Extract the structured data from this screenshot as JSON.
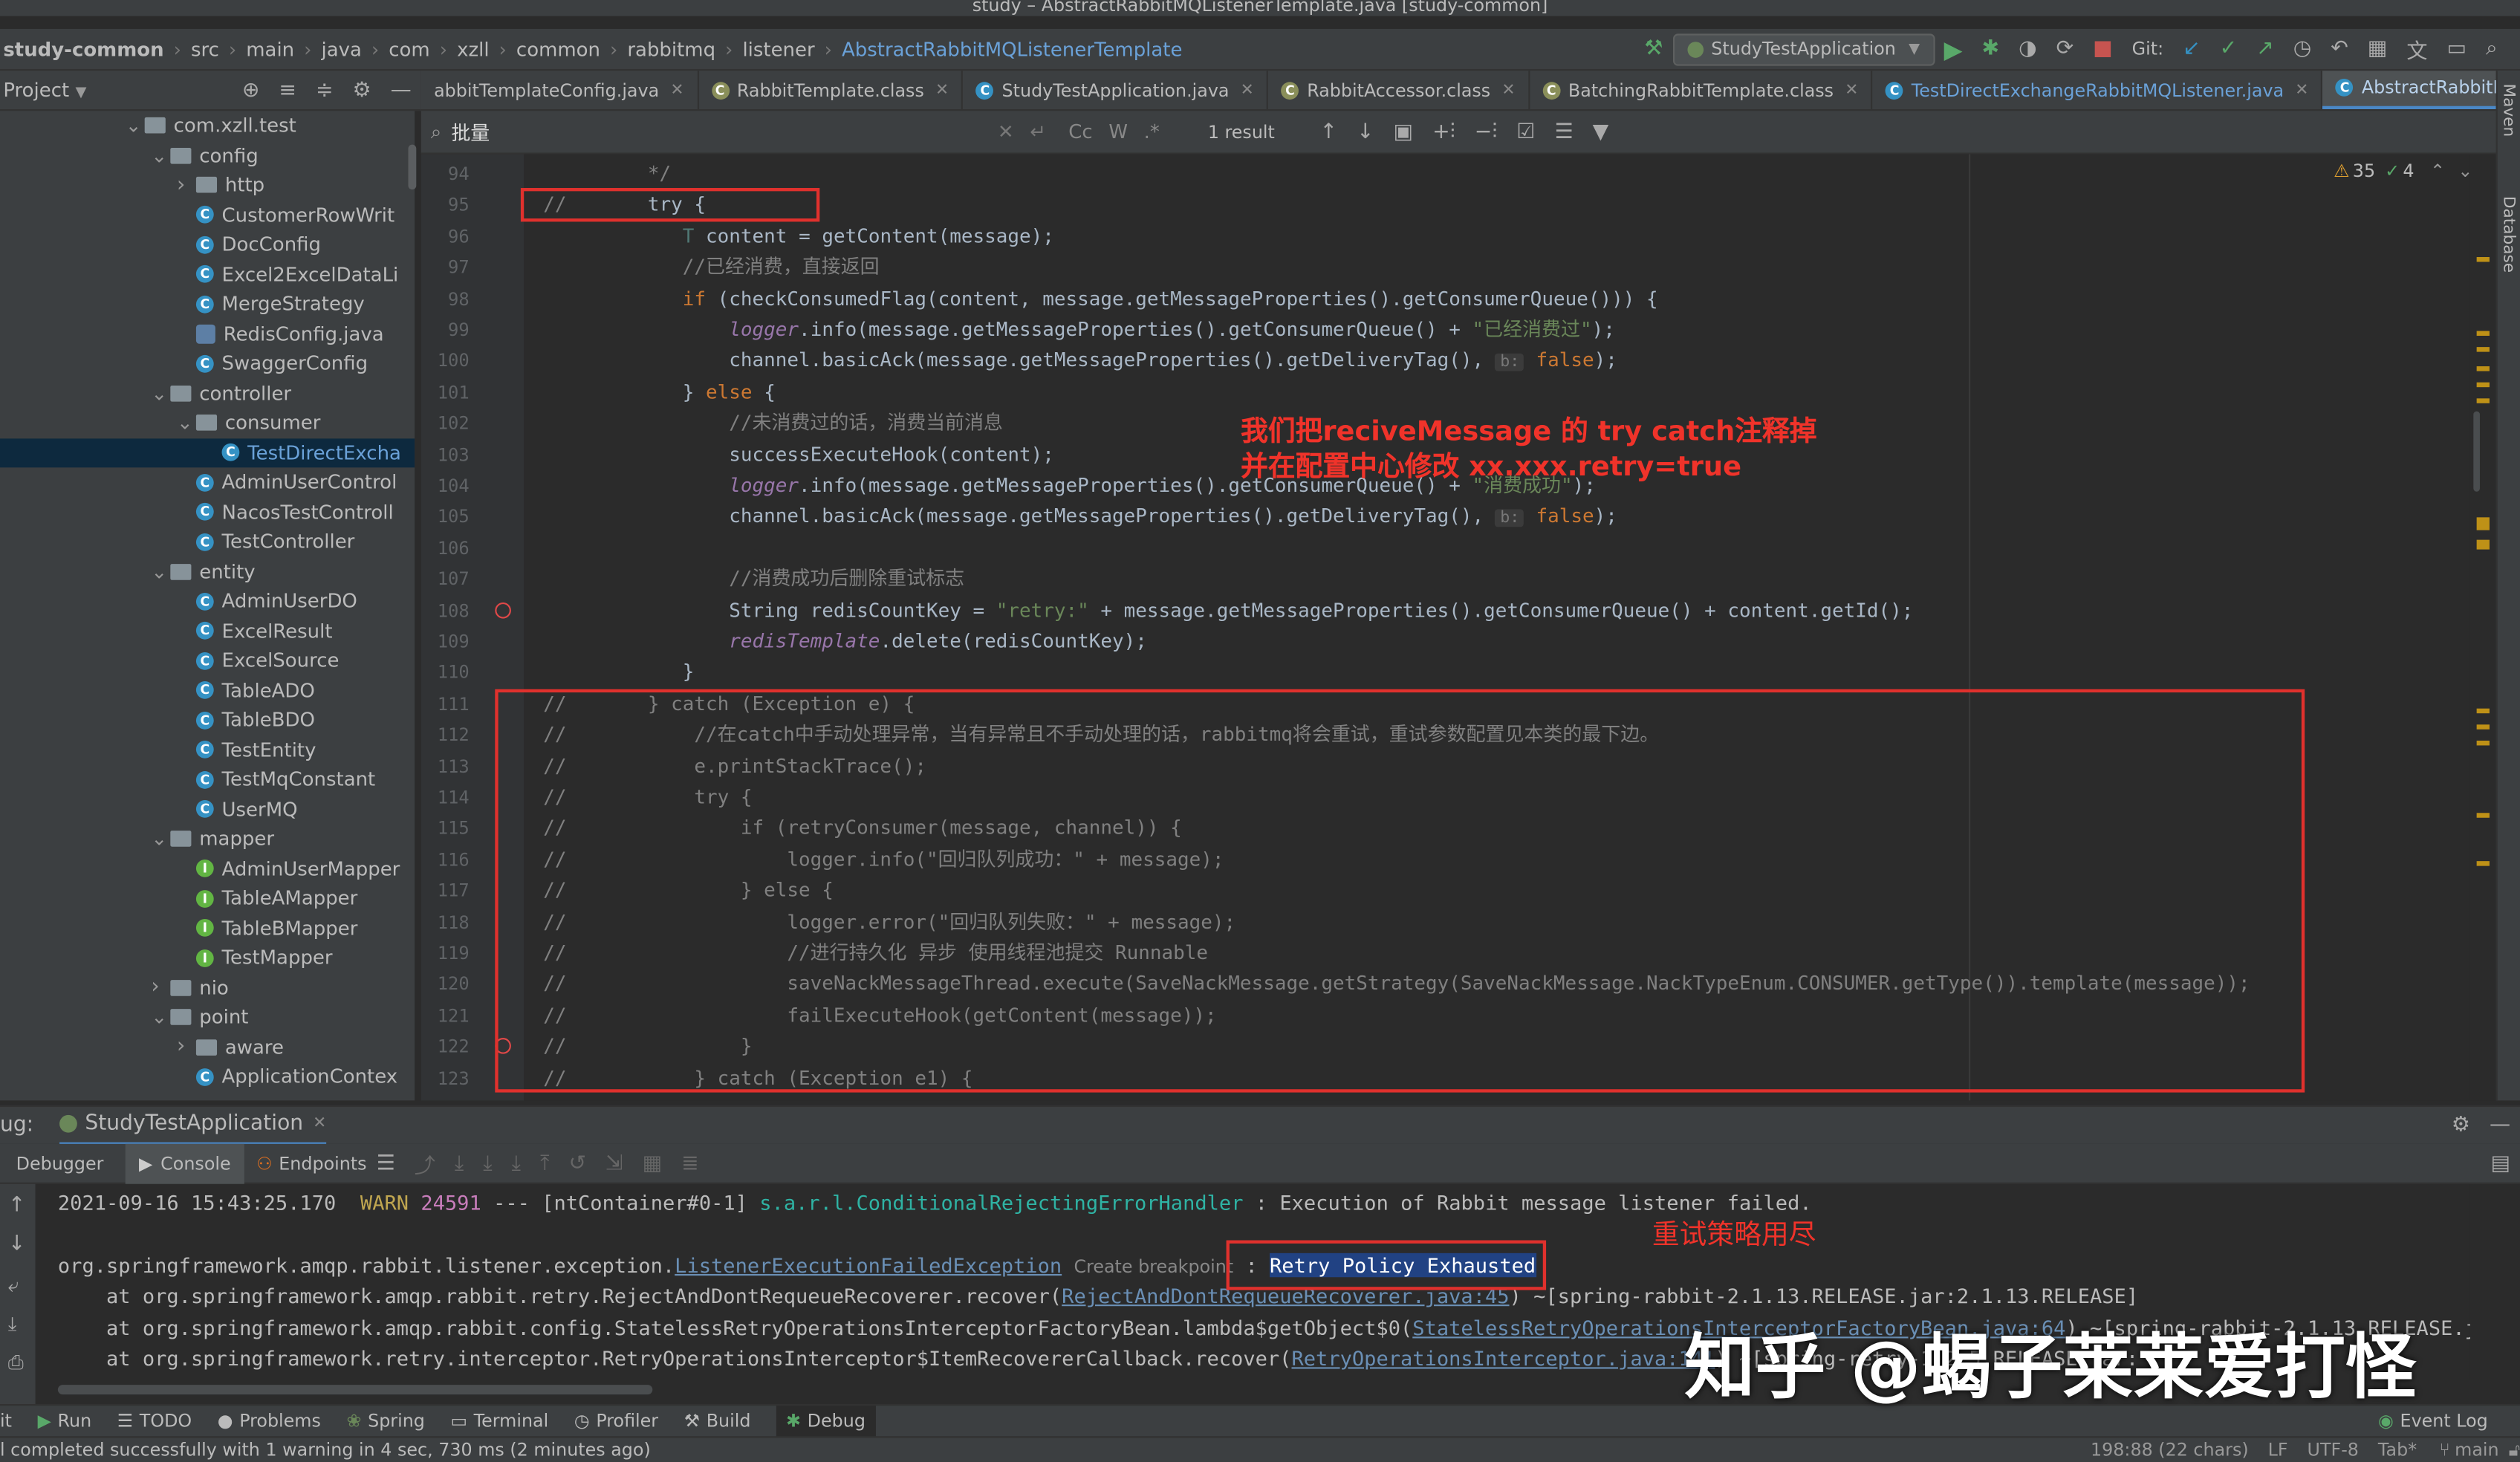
{
  "window_title": "study – AbstractRabbitMQListenerTemplate.java [study-common]",
  "breadcrumb": [
    "study-common",
    "src",
    "main",
    "java",
    "com",
    "xzll",
    "common",
    "rabbitmq",
    "listener",
    "AbstractRabbitMQListenerTemplate"
  ],
  "run_config": "StudyTestApplication",
  "git_label": "Git:",
  "project_panel": {
    "title": "Project"
  },
  "tree": [
    {
      "label": "com.xzll.test",
      "kind": "folder",
      "depth": 0,
      "open": true
    },
    {
      "label": "config",
      "kind": "folder",
      "depth": 1,
      "open": true
    },
    {
      "label": "http",
      "kind": "folder",
      "depth": 2,
      "open": false
    },
    {
      "label": "CustomerRowWrit",
      "kind": "class",
      "depth": 2
    },
    {
      "label": "DocConfig",
      "kind": "class",
      "depth": 2
    },
    {
      "label": "Excel2ExcelDataLi",
      "kind": "class",
      "depth": 2
    },
    {
      "label": "MergeStrategy",
      "kind": "class",
      "depth": 2
    },
    {
      "label": "RedisConfig.java",
      "kind": "java",
      "depth": 2
    },
    {
      "label": "SwaggerConfig",
      "kind": "class",
      "depth": 2
    },
    {
      "label": "controller",
      "kind": "folder",
      "depth": 1,
      "open": true
    },
    {
      "label": "consumer",
      "kind": "folder",
      "depth": 2,
      "open": true
    },
    {
      "label": "TestDirectExcha",
      "kind": "class",
      "depth": 3,
      "selected": true
    },
    {
      "label": "AdminUserControl",
      "kind": "class",
      "depth": 2
    },
    {
      "label": "NacosTestControll",
      "kind": "class",
      "depth": 2
    },
    {
      "label": "TestController",
      "kind": "class",
      "depth": 2
    },
    {
      "label": "entity",
      "kind": "folder",
      "depth": 1,
      "open": true
    },
    {
      "label": "AdminUserDO",
      "kind": "class",
      "depth": 2
    },
    {
      "label": "ExcelResult",
      "kind": "class",
      "depth": 2
    },
    {
      "label": "ExcelSource",
      "kind": "class",
      "depth": 2
    },
    {
      "label": "TableADO",
      "kind": "class",
      "depth": 2
    },
    {
      "label": "TableBDO",
      "kind": "class",
      "depth": 2
    },
    {
      "label": "TestEntity",
      "kind": "class",
      "depth": 2
    },
    {
      "label": "TestMqConstant",
      "kind": "class",
      "depth": 2
    },
    {
      "label": "UserMQ",
      "kind": "class",
      "depth": 2
    },
    {
      "label": "mapper",
      "kind": "folder",
      "depth": 1,
      "open": true
    },
    {
      "label": "AdminUserMapper",
      "kind": "interface",
      "depth": 2
    },
    {
      "label": "TableAMapper",
      "kind": "interface",
      "depth": 2
    },
    {
      "label": "TableBMapper",
      "kind": "interface",
      "depth": 2
    },
    {
      "label": "TestMapper",
      "kind": "interface",
      "depth": 2
    },
    {
      "label": "nio",
      "kind": "folder",
      "depth": 1,
      "open": false
    },
    {
      "label": "point",
      "kind": "folder",
      "depth": 1,
      "open": true
    },
    {
      "label": "aware",
      "kind": "folder",
      "depth": 2,
      "open": false
    },
    {
      "label": "ApplicationContex",
      "kind": "class",
      "depth": 2
    }
  ],
  "tabs": [
    {
      "label": "abbitTemplateConfig.java",
      "active": false
    },
    {
      "label": "RabbitTemplate.class",
      "active": false
    },
    {
      "label": "StudyTestApplication.java",
      "active": false
    },
    {
      "label": "RabbitAccessor.class",
      "active": false
    },
    {
      "label": "BatchingRabbitTemplate.class",
      "active": false
    },
    {
      "label": "TestDirectExchangeRabbitMQListener.java",
      "active": false
    },
    {
      "label": "AbstractRabbitMQListenerTemplate.java",
      "active": true
    }
  ],
  "search": {
    "query": "批量",
    "match_case": "Cc",
    "words": "W",
    "regex": ".*",
    "result": "1 result"
  },
  "inspections": {
    "warnings": "35",
    "ok": "4"
  },
  "line_numbers": [
    "94",
    "95",
    "96",
    "97",
    "98",
    "99",
    "100",
    "101",
    "102",
    "103",
    "104",
    "105",
    "106",
    "107",
    "108",
    "109",
    "110",
    "111",
    "112",
    "113",
    "114",
    "115",
    "116",
    "117",
    "118",
    "119",
    "120",
    "121",
    "122",
    "123"
  ],
  "code": [
    [
      {
        "t": "         */",
        "c": "cm"
      }
    ],
    [
      {
        "t": "//       ",
        "c": "cm"
      },
      {
        "t": "try {",
        "c": ""
      }
    ],
    [
      {
        "t": "            ",
        "c": ""
      },
      {
        "t": "T",
        "c": "typ"
      },
      {
        "t": " content = getContent(message);",
        "c": ""
      }
    ],
    [
      {
        "t": "            //已经消费，直接返回",
        "c": "cm"
      }
    ],
    [
      {
        "t": "            ",
        "c": ""
      },
      {
        "t": "if",
        "c": "kw"
      },
      {
        "t": " (checkConsumedFlag(content, message.getMessageProperties().getConsumerQueue())) {",
        "c": ""
      }
    ],
    [
      {
        "t": "                ",
        "c": ""
      },
      {
        "t": "logger",
        "c": "fld"
      },
      {
        "t": ".info(message.getMessageProperties().getConsumerQueue() + ",
        "c": ""
      },
      {
        "t": "\"已经消费过\"",
        "c": "str"
      },
      {
        "t": ");",
        "c": ""
      }
    ],
    [
      {
        "t": "                channel.basicAck(message.getMessageProperties().getDeliveryTag(), ",
        "c": ""
      },
      {
        "t": "b:",
        "c": "hint"
      },
      {
        "t": " ",
        "c": ""
      },
      {
        "t": "false",
        "c": "kw"
      },
      {
        "t": ");",
        "c": ""
      }
    ],
    [
      {
        "t": "            } ",
        "c": ""
      },
      {
        "t": "else",
        "c": "kw"
      },
      {
        "t": " {",
        "c": ""
      }
    ],
    [
      {
        "t": "                //未消费过的话，消费当前消息",
        "c": "cm"
      }
    ],
    [
      {
        "t": "                successExecuteHook(content);",
        "c": ""
      }
    ],
    [
      {
        "t": "                ",
        "c": ""
      },
      {
        "t": "logger",
        "c": "fld"
      },
      {
        "t": ".info(message.getMessageProperties().getConsumerQueue() + ",
        "c": ""
      },
      {
        "t": "\"消费成功\"",
        "c": "str"
      },
      {
        "t": ");",
        "c": ""
      }
    ],
    [
      {
        "t": "                channel.basicAck(message.getMessageProperties().getDeliveryTag(), ",
        "c": ""
      },
      {
        "t": "b:",
        "c": "hint"
      },
      {
        "t": " ",
        "c": ""
      },
      {
        "t": "false",
        "c": "kw"
      },
      {
        "t": ");",
        "c": ""
      }
    ],
    [
      {
        "t": "",
        "c": ""
      }
    ],
    [
      {
        "t": "                //消费成功后删除重试标志",
        "c": "cm"
      }
    ],
    [
      {
        "t": "                String redisCountKey = ",
        "c": ""
      },
      {
        "t": "\"retry:\"",
        "c": "str"
      },
      {
        "t": " + message.getMessageProperties().getConsumerQueue() + content.getId();",
        "c": ""
      }
    ],
    [
      {
        "t": "                ",
        "c": ""
      },
      {
        "t": "redisTemplate",
        "c": "fld"
      },
      {
        "t": ".delete(redisCountKey);",
        "c": ""
      }
    ],
    [
      {
        "t": "            }",
        "c": ""
      }
    ],
    [
      {
        "t": "//       } catch (Exception e) {",
        "c": "cm"
      }
    ],
    [
      {
        "t": "//           //在catch中手动处理异常，当有异常且不手动处理的话，rabbitmq将会重试，重试参数配置见本类的最下边。",
        "c": "cm"
      }
    ],
    [
      {
        "t": "//           e.printStackTrace();",
        "c": "cm"
      }
    ],
    [
      {
        "t": "//           try {",
        "c": "cm"
      }
    ],
    [
      {
        "t": "//               if (retryConsumer(message, channel)) {",
        "c": "cm"
      }
    ],
    [
      {
        "t": "//                   logger.info(\"回归队列成功：\" + message);",
        "c": "cm"
      }
    ],
    [
      {
        "t": "//               } else {",
        "c": "cm"
      }
    ],
    [
      {
        "t": "//                   logger.error(\"回归队列失败：\" + message);",
        "c": "cm"
      }
    ],
    [
      {
        "t": "//                   //进行持久化 异步 使用线程池提交 Runnable",
        "c": "cm"
      }
    ],
    [
      {
        "t": "//                   saveNackMessageThread.execute(SaveNackMessage.getStrategy(SaveNackMessage.NackTypeEnum.CONSUMER.getType()).template(message));",
        "c": "cm"
      }
    ],
    [
      {
        "t": "//                   failExecuteHook(getContent(message));",
        "c": "cm"
      }
    ],
    [
      {
        "t": "//               }",
        "c": "cm"
      }
    ],
    [
      {
        "t": "//           } catch (Exception e1) {",
        "c": "cm"
      }
    ]
  ],
  "annotation_editor": [
    "我们把reciveMessage 的 try catch注释掉",
    "并在配置中心修改 xx.xxx.retry=true"
  ],
  "annotation_console": "重试策略用尽",
  "debug": {
    "label": "ug:",
    "config": "StudyTestApplication",
    "tabs": [
      "Debugger",
      "Console",
      "Endpoints"
    ]
  },
  "console": {
    "line1": {
      "ts": "2021-09-16 15:43:25.170",
      "level": "WARN",
      "pid": "24591",
      "mid": "--- [ntContainer#0-1]",
      "logger": "s.a.r.l.ConditionalRejectingErrorHandler",
      "msg": " : Execution of Rabbit message listener failed."
    },
    "line2": {
      "pre": "org.springframework.amqp.rabbit.listener.exception.",
      "link": "ListenerExecutionFailedException",
      "hint": "Create breakpoint",
      "colon": " : ",
      "msg": "Retry Policy Exhausted"
    },
    "line3": {
      "pre": "    at org.springframework.amqp.rabbit.retry.RejectAndDontRequeueRecoverer.recover(",
      "link": "RejectAndDontRequeueRecoverer.java:45",
      "post": ") ~[spring-rabbit-2.1.13.RELEASE.jar:2.1.13.RELEASE]"
    },
    "line4": {
      "pre": "    at org.springframework.amqp.rabbit.config.StatelessRetryOperationsInterceptorFactoryBean.lambda$getObject$0(",
      "link": "StatelessRetryOperationsInterceptorFactoryBean.java:64",
      "post": ") ~[spring-rabbit-2.1.13.RELEASE.jar:"
    },
    "line5": {
      "pre": "    at org.springframework.retry.interceptor.RetryOperationsInterceptor$ItemRecovererCallback.recover(",
      "link": "RetryOperationsInterceptor.java:141",
      "post": ") ~[spring-retry-1.2.5.RELEASE.jar:"
    }
  },
  "bottom_tools": [
    "it",
    "Run",
    "TODO",
    "Problems",
    "Spring",
    "Terminal",
    "Profiler",
    "Build",
    "Debug"
  ],
  "event_log": "Event Log",
  "status": {
    "left": "l completed successfully with 1 warning in 4 sec, 730 ms (2 minutes ago)",
    "pos": "198:88 (22 chars)",
    "lf": "LF",
    "enc": "UTF-8",
    "indent": "Tab*",
    "branch": "main"
  },
  "watermark": "知乎 @蝎子莱莱爱打怪",
  "side_labels": {
    "maven": "Maven",
    "database": "Database"
  }
}
